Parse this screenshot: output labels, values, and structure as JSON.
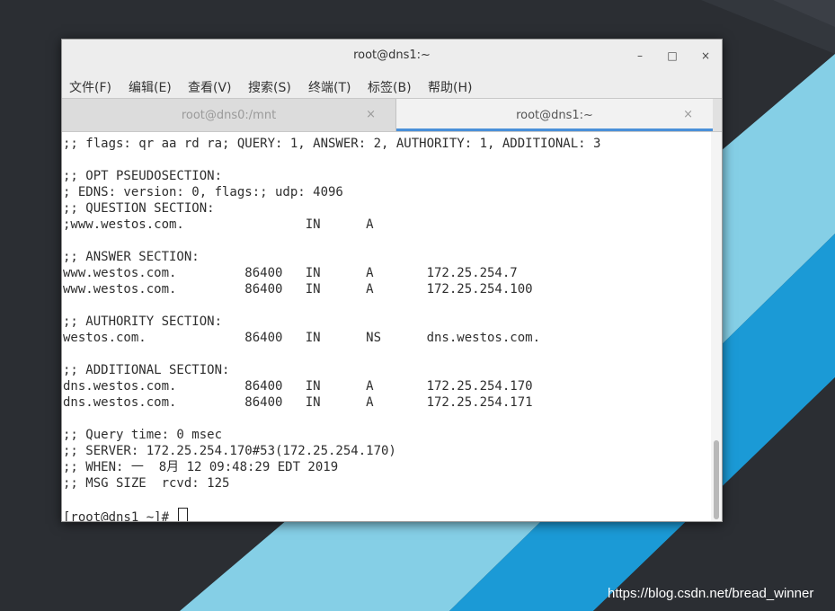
{
  "window": {
    "title": "root@dns1:~",
    "minimize_glyph": "–",
    "maximize_glyph": "□",
    "close_glyph": "×"
  },
  "menu": [
    "文件(F)",
    "编辑(E)",
    "查看(V)",
    "搜索(S)",
    "终端(T)",
    "标签(B)",
    "帮助(H)"
  ],
  "tabs": [
    {
      "label": "root@dns0:/mnt",
      "close": "×",
      "active": false
    },
    {
      "label": "root@dns1:~",
      "close": "×",
      "active": true
    }
  ],
  "terminal": {
    "lines": [
      ";; flags: qr aa rd ra; QUERY: 1, ANSWER: 2, AUTHORITY: 1, ADDITIONAL: 3",
      "",
      ";; OPT PSEUDOSECTION:",
      "; EDNS: version: 0, flags:; udp: 4096",
      ";; QUESTION SECTION:",
      ";www.westos.com.                IN      A",
      "",
      ";; ANSWER SECTION:",
      "www.westos.com.         86400   IN      A       172.25.254.7",
      "www.westos.com.         86400   IN      A       172.25.254.100",
      "",
      ";; AUTHORITY SECTION:",
      "westos.com.             86400   IN      NS      dns.westos.com.",
      "",
      ";; ADDITIONAL SECTION:",
      "dns.westos.com.         86400   IN      A       172.25.254.170",
      "dns.westos.com.         86400   IN      A       172.25.254.171",
      "",
      ";; Query time: 0 msec",
      ";; SERVER: 172.25.254.170#53(172.25.254.170)",
      ";; WHEN: 一  8月 12 09:48:29 EDT 2019",
      ";; MSG SIZE  rcvd: 125",
      ""
    ],
    "prompt": "[root@dns1 ~]# "
  },
  "watermark": "https://blog.csdn.net/bread_winner",
  "colors": {
    "desktop_dark": "#2b2e33",
    "stripe_light": "#85cfe6",
    "stripe_blue": "#1b9ad6",
    "tab_accent": "#4a90d9"
  }
}
